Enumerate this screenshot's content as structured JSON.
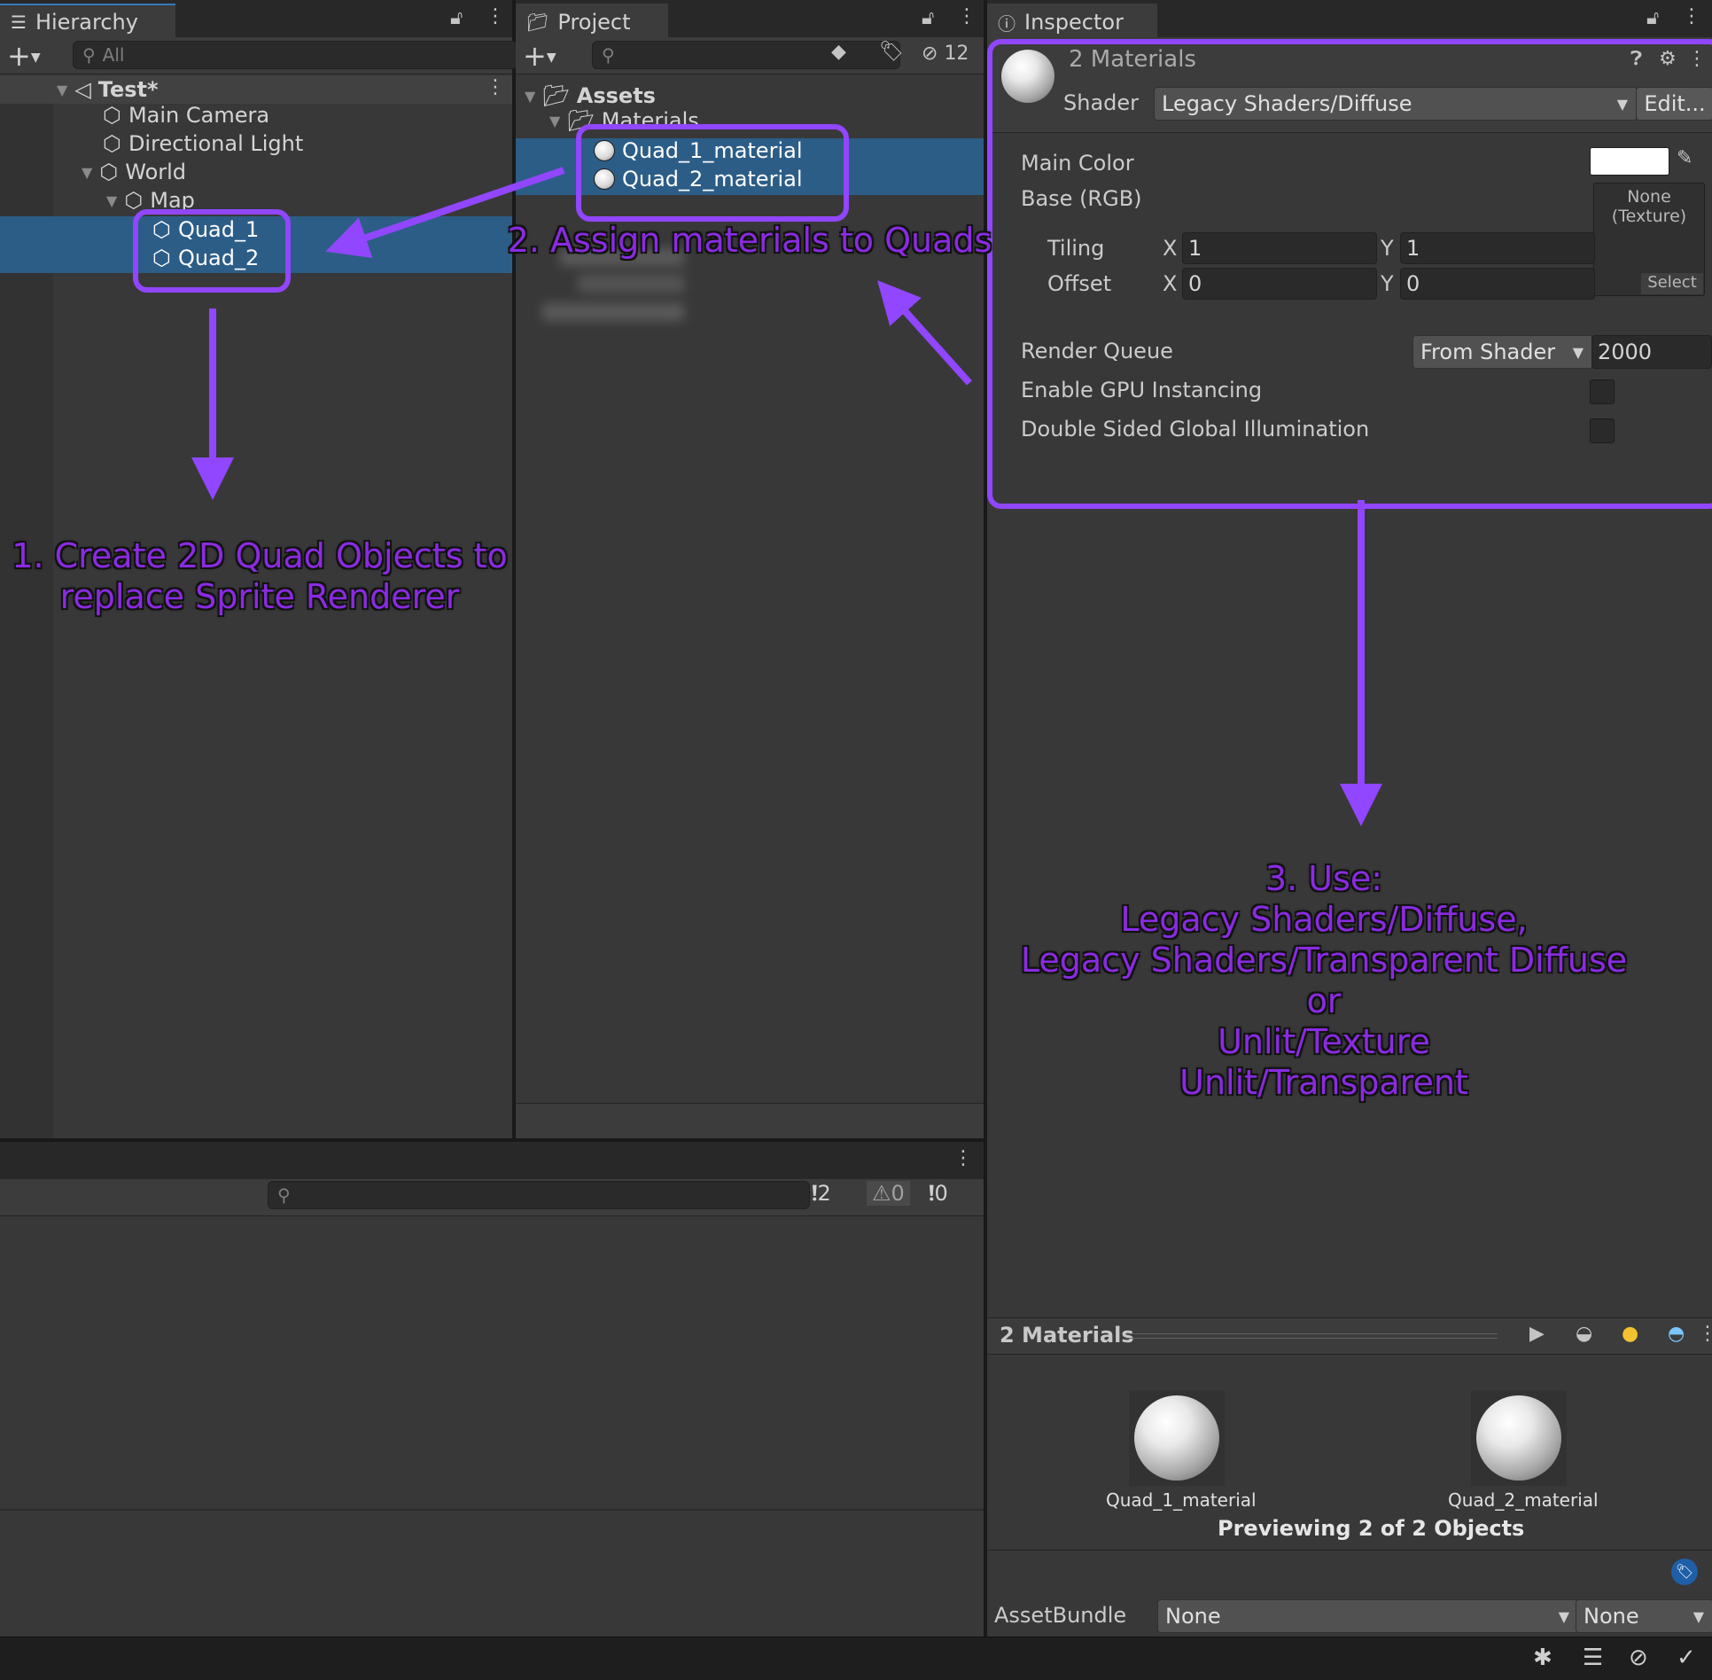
{
  "hierarchy": {
    "tab_label": "Hierarchy",
    "search_placeholder": "All",
    "scene_name": "Test*",
    "items": [
      "Main Camera",
      "Directional Light",
      "World",
      "Map",
      "Quad_1",
      "Quad_2"
    ]
  },
  "project": {
    "tab_label": "Project",
    "hidden_count": "12",
    "root_folder": "Assets",
    "sub_folder": "Materials",
    "items": [
      "Quad_1_material",
      "Quad_2_material"
    ]
  },
  "console": {
    "log_count": "2",
    "warning_count": "0",
    "error_count": "0"
  },
  "inspector": {
    "tab_label": "Inspector",
    "title": "2 Materials",
    "shader_label": "Shader",
    "shader_value": "Legacy Shaders/Diffuse",
    "edit_button": "Edit...",
    "main_color_label": "Main Color",
    "base_label": "Base (RGB)",
    "texture_none": "None",
    "texture_type": "(Texture)",
    "select_button": "Select",
    "tiling_label": "Tiling",
    "offset_label": "Offset",
    "x_label": "X",
    "y_label": "Y",
    "tiling_x": "1",
    "tiling_y": "1",
    "offset_x": "0",
    "offset_y": "0",
    "render_queue_label": "Render Queue",
    "render_queue_mode": "From Shader",
    "render_queue_value": "2000",
    "gpu_instancing_label": "Enable GPU Instancing",
    "double_sided_label": "Double Sided Global Illumination",
    "main_color_hex": "#ffffff"
  },
  "preview": {
    "title": "2 Materials",
    "item_1": "Quad_1_material",
    "item_2": "Quad_2_material",
    "caption": "Previewing 2 of 2 Objects",
    "assetbundle_label": "AssetBundle",
    "assetbundle_value": "None",
    "assetbundle_variant": "None"
  },
  "annotations": {
    "step1_line1": "1. Create 2D Quad Objects to",
    "step1_line2": "replace Sprite Renderer",
    "step2": "2. Assign materials to Quads",
    "step3_line1": "3. Use:",
    "step3_line2": "Legacy Shaders/Diffuse,",
    "step3_line3": "Legacy Shaders/Transparent Diffuse",
    "step3_line4": "or",
    "step3_line5": "Unlit/Texture",
    "step3_line6": "Unlit/Transparent",
    "color": "#9146ff"
  }
}
